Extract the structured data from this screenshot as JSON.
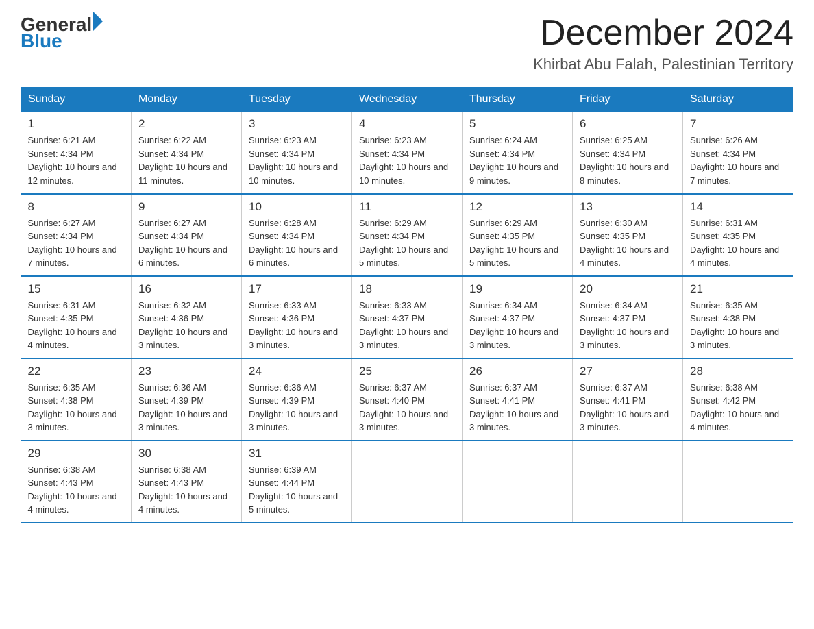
{
  "header": {
    "logo_general": "General",
    "logo_blue": "Blue",
    "title": "December 2024",
    "subtitle": "Khirbat Abu Falah, Palestinian Territory"
  },
  "weekdays": [
    "Sunday",
    "Monday",
    "Tuesday",
    "Wednesday",
    "Thursday",
    "Friday",
    "Saturday"
  ],
  "weeks": [
    [
      {
        "day": "1",
        "sunrise": "6:21 AM",
        "sunset": "4:34 PM",
        "daylight": "10 hours and 12 minutes."
      },
      {
        "day": "2",
        "sunrise": "6:22 AM",
        "sunset": "4:34 PM",
        "daylight": "10 hours and 11 minutes."
      },
      {
        "day": "3",
        "sunrise": "6:23 AM",
        "sunset": "4:34 PM",
        "daylight": "10 hours and 10 minutes."
      },
      {
        "day": "4",
        "sunrise": "6:23 AM",
        "sunset": "4:34 PM",
        "daylight": "10 hours and 10 minutes."
      },
      {
        "day": "5",
        "sunrise": "6:24 AM",
        "sunset": "4:34 PM",
        "daylight": "10 hours and 9 minutes."
      },
      {
        "day": "6",
        "sunrise": "6:25 AM",
        "sunset": "4:34 PM",
        "daylight": "10 hours and 8 minutes."
      },
      {
        "day": "7",
        "sunrise": "6:26 AM",
        "sunset": "4:34 PM",
        "daylight": "10 hours and 7 minutes."
      }
    ],
    [
      {
        "day": "8",
        "sunrise": "6:27 AM",
        "sunset": "4:34 PM",
        "daylight": "10 hours and 7 minutes."
      },
      {
        "day": "9",
        "sunrise": "6:27 AM",
        "sunset": "4:34 PM",
        "daylight": "10 hours and 6 minutes."
      },
      {
        "day": "10",
        "sunrise": "6:28 AM",
        "sunset": "4:34 PM",
        "daylight": "10 hours and 6 minutes."
      },
      {
        "day": "11",
        "sunrise": "6:29 AM",
        "sunset": "4:34 PM",
        "daylight": "10 hours and 5 minutes."
      },
      {
        "day": "12",
        "sunrise": "6:29 AM",
        "sunset": "4:35 PM",
        "daylight": "10 hours and 5 minutes."
      },
      {
        "day": "13",
        "sunrise": "6:30 AM",
        "sunset": "4:35 PM",
        "daylight": "10 hours and 4 minutes."
      },
      {
        "day": "14",
        "sunrise": "6:31 AM",
        "sunset": "4:35 PM",
        "daylight": "10 hours and 4 minutes."
      }
    ],
    [
      {
        "day": "15",
        "sunrise": "6:31 AM",
        "sunset": "4:35 PM",
        "daylight": "10 hours and 4 minutes."
      },
      {
        "day": "16",
        "sunrise": "6:32 AM",
        "sunset": "4:36 PM",
        "daylight": "10 hours and 3 minutes."
      },
      {
        "day": "17",
        "sunrise": "6:33 AM",
        "sunset": "4:36 PM",
        "daylight": "10 hours and 3 minutes."
      },
      {
        "day": "18",
        "sunrise": "6:33 AM",
        "sunset": "4:37 PM",
        "daylight": "10 hours and 3 minutes."
      },
      {
        "day": "19",
        "sunrise": "6:34 AM",
        "sunset": "4:37 PM",
        "daylight": "10 hours and 3 minutes."
      },
      {
        "day": "20",
        "sunrise": "6:34 AM",
        "sunset": "4:37 PM",
        "daylight": "10 hours and 3 minutes."
      },
      {
        "day": "21",
        "sunrise": "6:35 AM",
        "sunset": "4:38 PM",
        "daylight": "10 hours and 3 minutes."
      }
    ],
    [
      {
        "day": "22",
        "sunrise": "6:35 AM",
        "sunset": "4:38 PM",
        "daylight": "10 hours and 3 minutes."
      },
      {
        "day": "23",
        "sunrise": "6:36 AM",
        "sunset": "4:39 PM",
        "daylight": "10 hours and 3 minutes."
      },
      {
        "day": "24",
        "sunrise": "6:36 AM",
        "sunset": "4:39 PM",
        "daylight": "10 hours and 3 minutes."
      },
      {
        "day": "25",
        "sunrise": "6:37 AM",
        "sunset": "4:40 PM",
        "daylight": "10 hours and 3 minutes."
      },
      {
        "day": "26",
        "sunrise": "6:37 AM",
        "sunset": "4:41 PM",
        "daylight": "10 hours and 3 minutes."
      },
      {
        "day": "27",
        "sunrise": "6:37 AM",
        "sunset": "4:41 PM",
        "daylight": "10 hours and 3 minutes."
      },
      {
        "day": "28",
        "sunrise": "6:38 AM",
        "sunset": "4:42 PM",
        "daylight": "10 hours and 4 minutes."
      }
    ],
    [
      {
        "day": "29",
        "sunrise": "6:38 AM",
        "sunset": "4:43 PM",
        "daylight": "10 hours and 4 minutes."
      },
      {
        "day": "30",
        "sunrise": "6:38 AM",
        "sunset": "4:43 PM",
        "daylight": "10 hours and 4 minutes."
      },
      {
        "day": "31",
        "sunrise": "6:39 AM",
        "sunset": "4:44 PM",
        "daylight": "10 hours and 5 minutes."
      },
      null,
      null,
      null,
      null
    ]
  ]
}
